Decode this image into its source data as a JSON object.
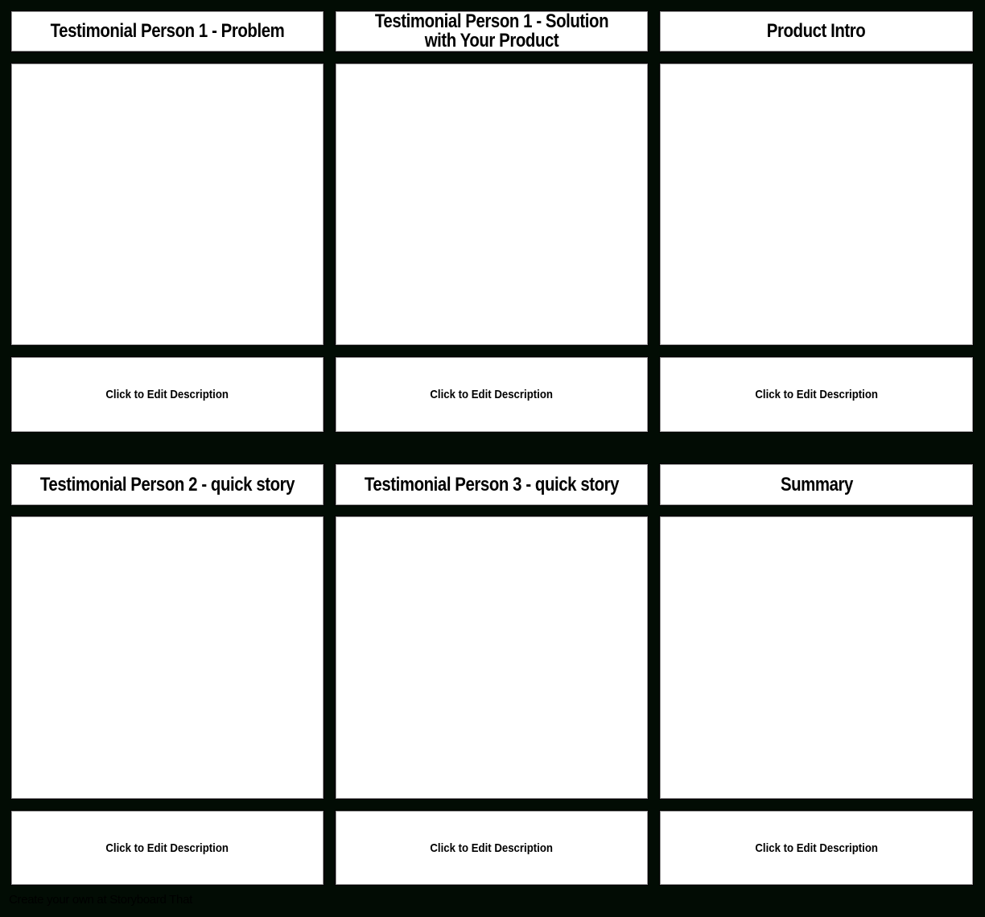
{
  "storyboard": {
    "rows": [
      {
        "cells": [
          {
            "title": "Testimonial Person 1 - Problem",
            "description": "Click to Edit Description"
          },
          {
            "title": "Testimonial Person 1 - Solution with Your Product",
            "description": "Click to Edit Description"
          },
          {
            "title": "Product Intro",
            "description": "Click to Edit Description"
          }
        ]
      },
      {
        "cells": [
          {
            "title": "Testimonial Person 2 - quick story",
            "description": "Click to Edit Description"
          },
          {
            "title": "Testimonial Person 3 - quick story",
            "description": "Click to Edit Description"
          },
          {
            "title": "Summary",
            "description": "Click to Edit Description"
          }
        ]
      }
    ]
  },
  "footer": {
    "text": "Create your own at Storyboard That"
  },
  "colors": {
    "background": "#020c04",
    "cell": "#ffffff",
    "text": "#000000"
  }
}
